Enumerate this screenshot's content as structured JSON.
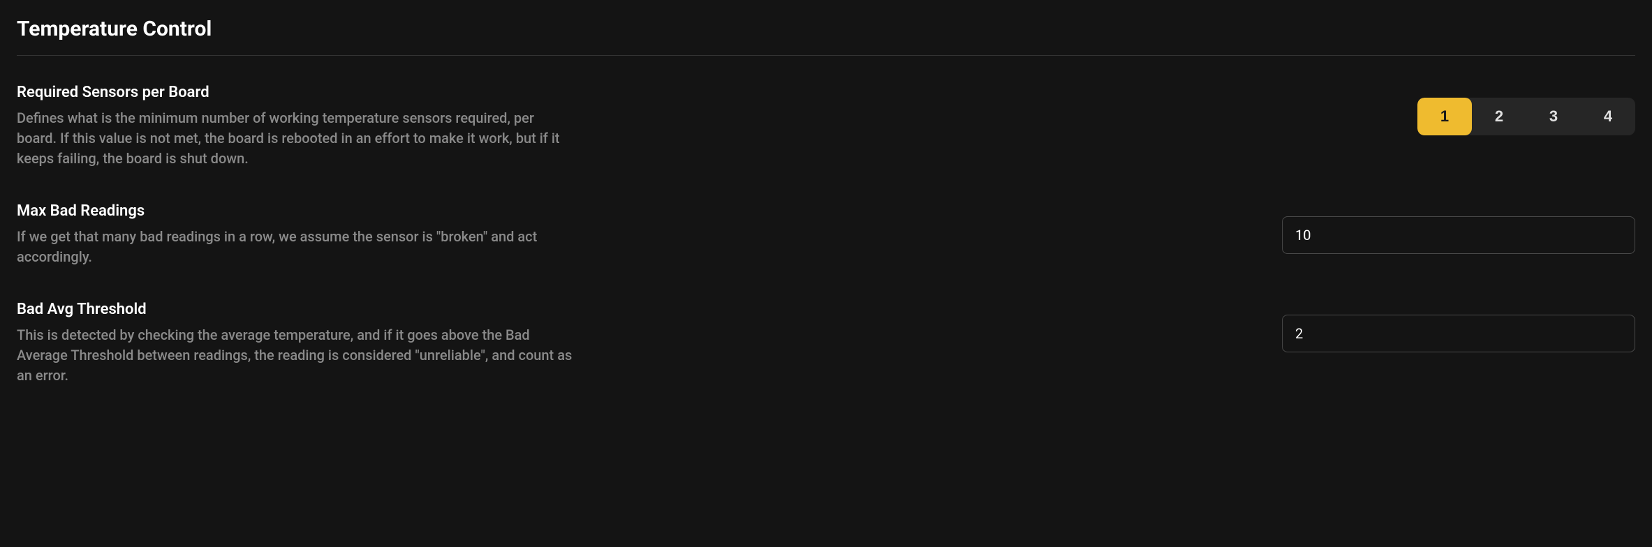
{
  "section": {
    "title": "Temperature Control"
  },
  "settings": {
    "requiredSensors": {
      "label": "Required Sensors per Board",
      "description": "Defines what is the minimum number of working temperature sensors required, per board. If this value is not met, the board is rebooted in an effort to make it work, but if it keeps failing, the board is shut down.",
      "options": [
        "1",
        "2",
        "3",
        "4"
      ],
      "selected": "1"
    },
    "maxBadReadings": {
      "label": "Max Bad Readings",
      "description": "If we get that many bad readings in a row, we assume the sensor is \"broken\" and act accordingly.",
      "value": "10"
    },
    "badAvgThreshold": {
      "label": "Bad Avg Threshold",
      "description": "This is detected by checking the average temperature, and if it goes above the Bad Average Threshold between readings, the reading is considered \"unreliable\", and count as an error.",
      "value": "2"
    }
  }
}
